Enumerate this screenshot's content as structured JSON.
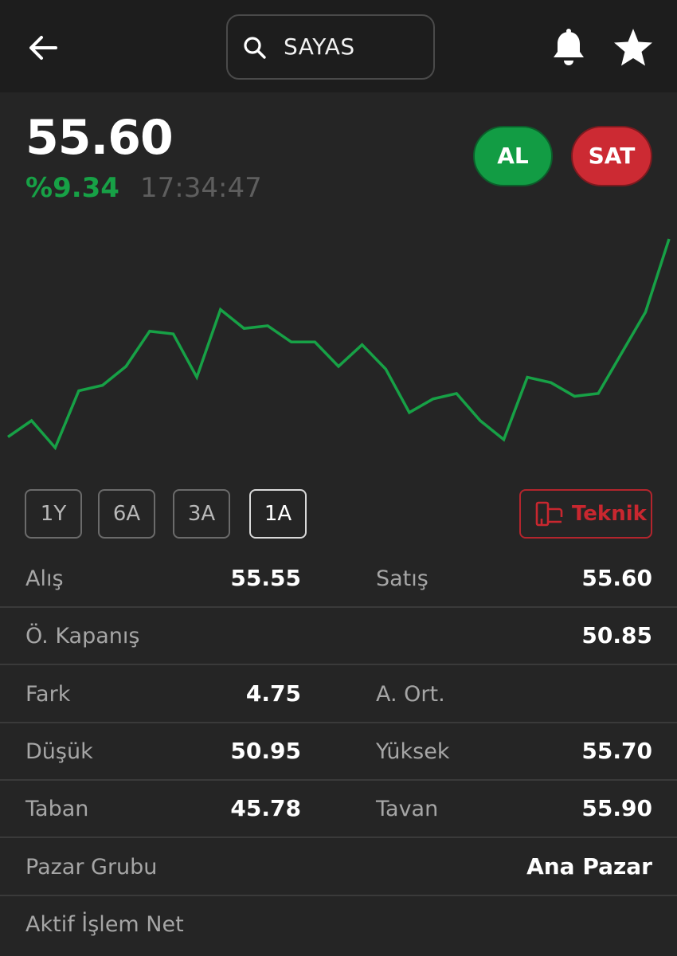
{
  "header": {
    "search_value": "SAYAS"
  },
  "quote": {
    "price": "55.60",
    "change": "%9.34",
    "time": "17:34:47",
    "buy_label": "AL",
    "sell_label": "SAT"
  },
  "colors": {
    "positive": "#17a146",
    "buy": "#129c44",
    "sell": "#cc2a33",
    "background": "#252525",
    "topbar": "#1d1d1d"
  },
  "chart_data": {
    "type": "line",
    "title": "",
    "xlabel": "",
    "ylabel": "",
    "grid": false,
    "color": "#17a146",
    "values": [
      48.3,
      48.9,
      47.9,
      50.0,
      50.2,
      50.9,
      52.2,
      52.1,
      50.5,
      53.0,
      52.3,
      52.4,
      51.8,
      51.8,
      50.9,
      51.7,
      50.8,
      49.2,
      49.7,
      49.9,
      48.9,
      48.2,
      50.5,
      50.3,
      49.8,
      49.9,
      51.4,
      52.9,
      55.6
    ]
  },
  "periods": [
    {
      "label": "1Y",
      "active": false
    },
    {
      "label": "6A",
      "active": false
    },
    {
      "label": "3A",
      "active": false
    },
    {
      "label": "1A",
      "active": true
    }
  ],
  "teknik_label": "Teknik",
  "details": [
    {
      "label1": "Alış",
      "value1": "55.55",
      "label2": "Satış",
      "value2": "55.60"
    },
    {
      "label1": "Ö. Kapanış",
      "value1": "",
      "label2": "",
      "value2": "50.85"
    },
    {
      "label1": "Fark",
      "value1": "4.75",
      "label2": "A. Ort.",
      "value2": ""
    },
    {
      "label1": "Düşük",
      "value1": "50.95",
      "label2": "Yüksek",
      "value2": "55.70"
    },
    {
      "label1": "Taban",
      "value1": "45.78",
      "label2": "Tavan",
      "value2": "55.90"
    },
    {
      "label1": "Pazar Grubu",
      "value1": "",
      "label2": "",
      "value2": "Ana Pazar"
    },
    {
      "label1": "Aktif İşlem Net",
      "value1": "",
      "label2": "",
      "value2": ""
    }
  ]
}
